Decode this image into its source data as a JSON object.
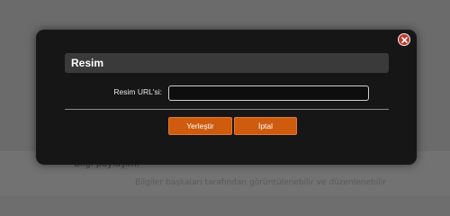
{
  "background": {
    "heading": "Bilgi paylaşımı",
    "text": "Bilgiler başkaları tarafından görüntülenebilir ve düzenlenebilir"
  },
  "dialog": {
    "title": "Resim",
    "url_label": "Resim URL'si:",
    "url_value": "",
    "insert_label": "Yerleştir",
    "cancel_label": "İptal",
    "close_icon": "close-icon"
  },
  "colors": {
    "dialog_bg": "#161616",
    "title_bar": "#3a3a3a",
    "button": "#cf5b0f",
    "close": "#c0392b"
  }
}
